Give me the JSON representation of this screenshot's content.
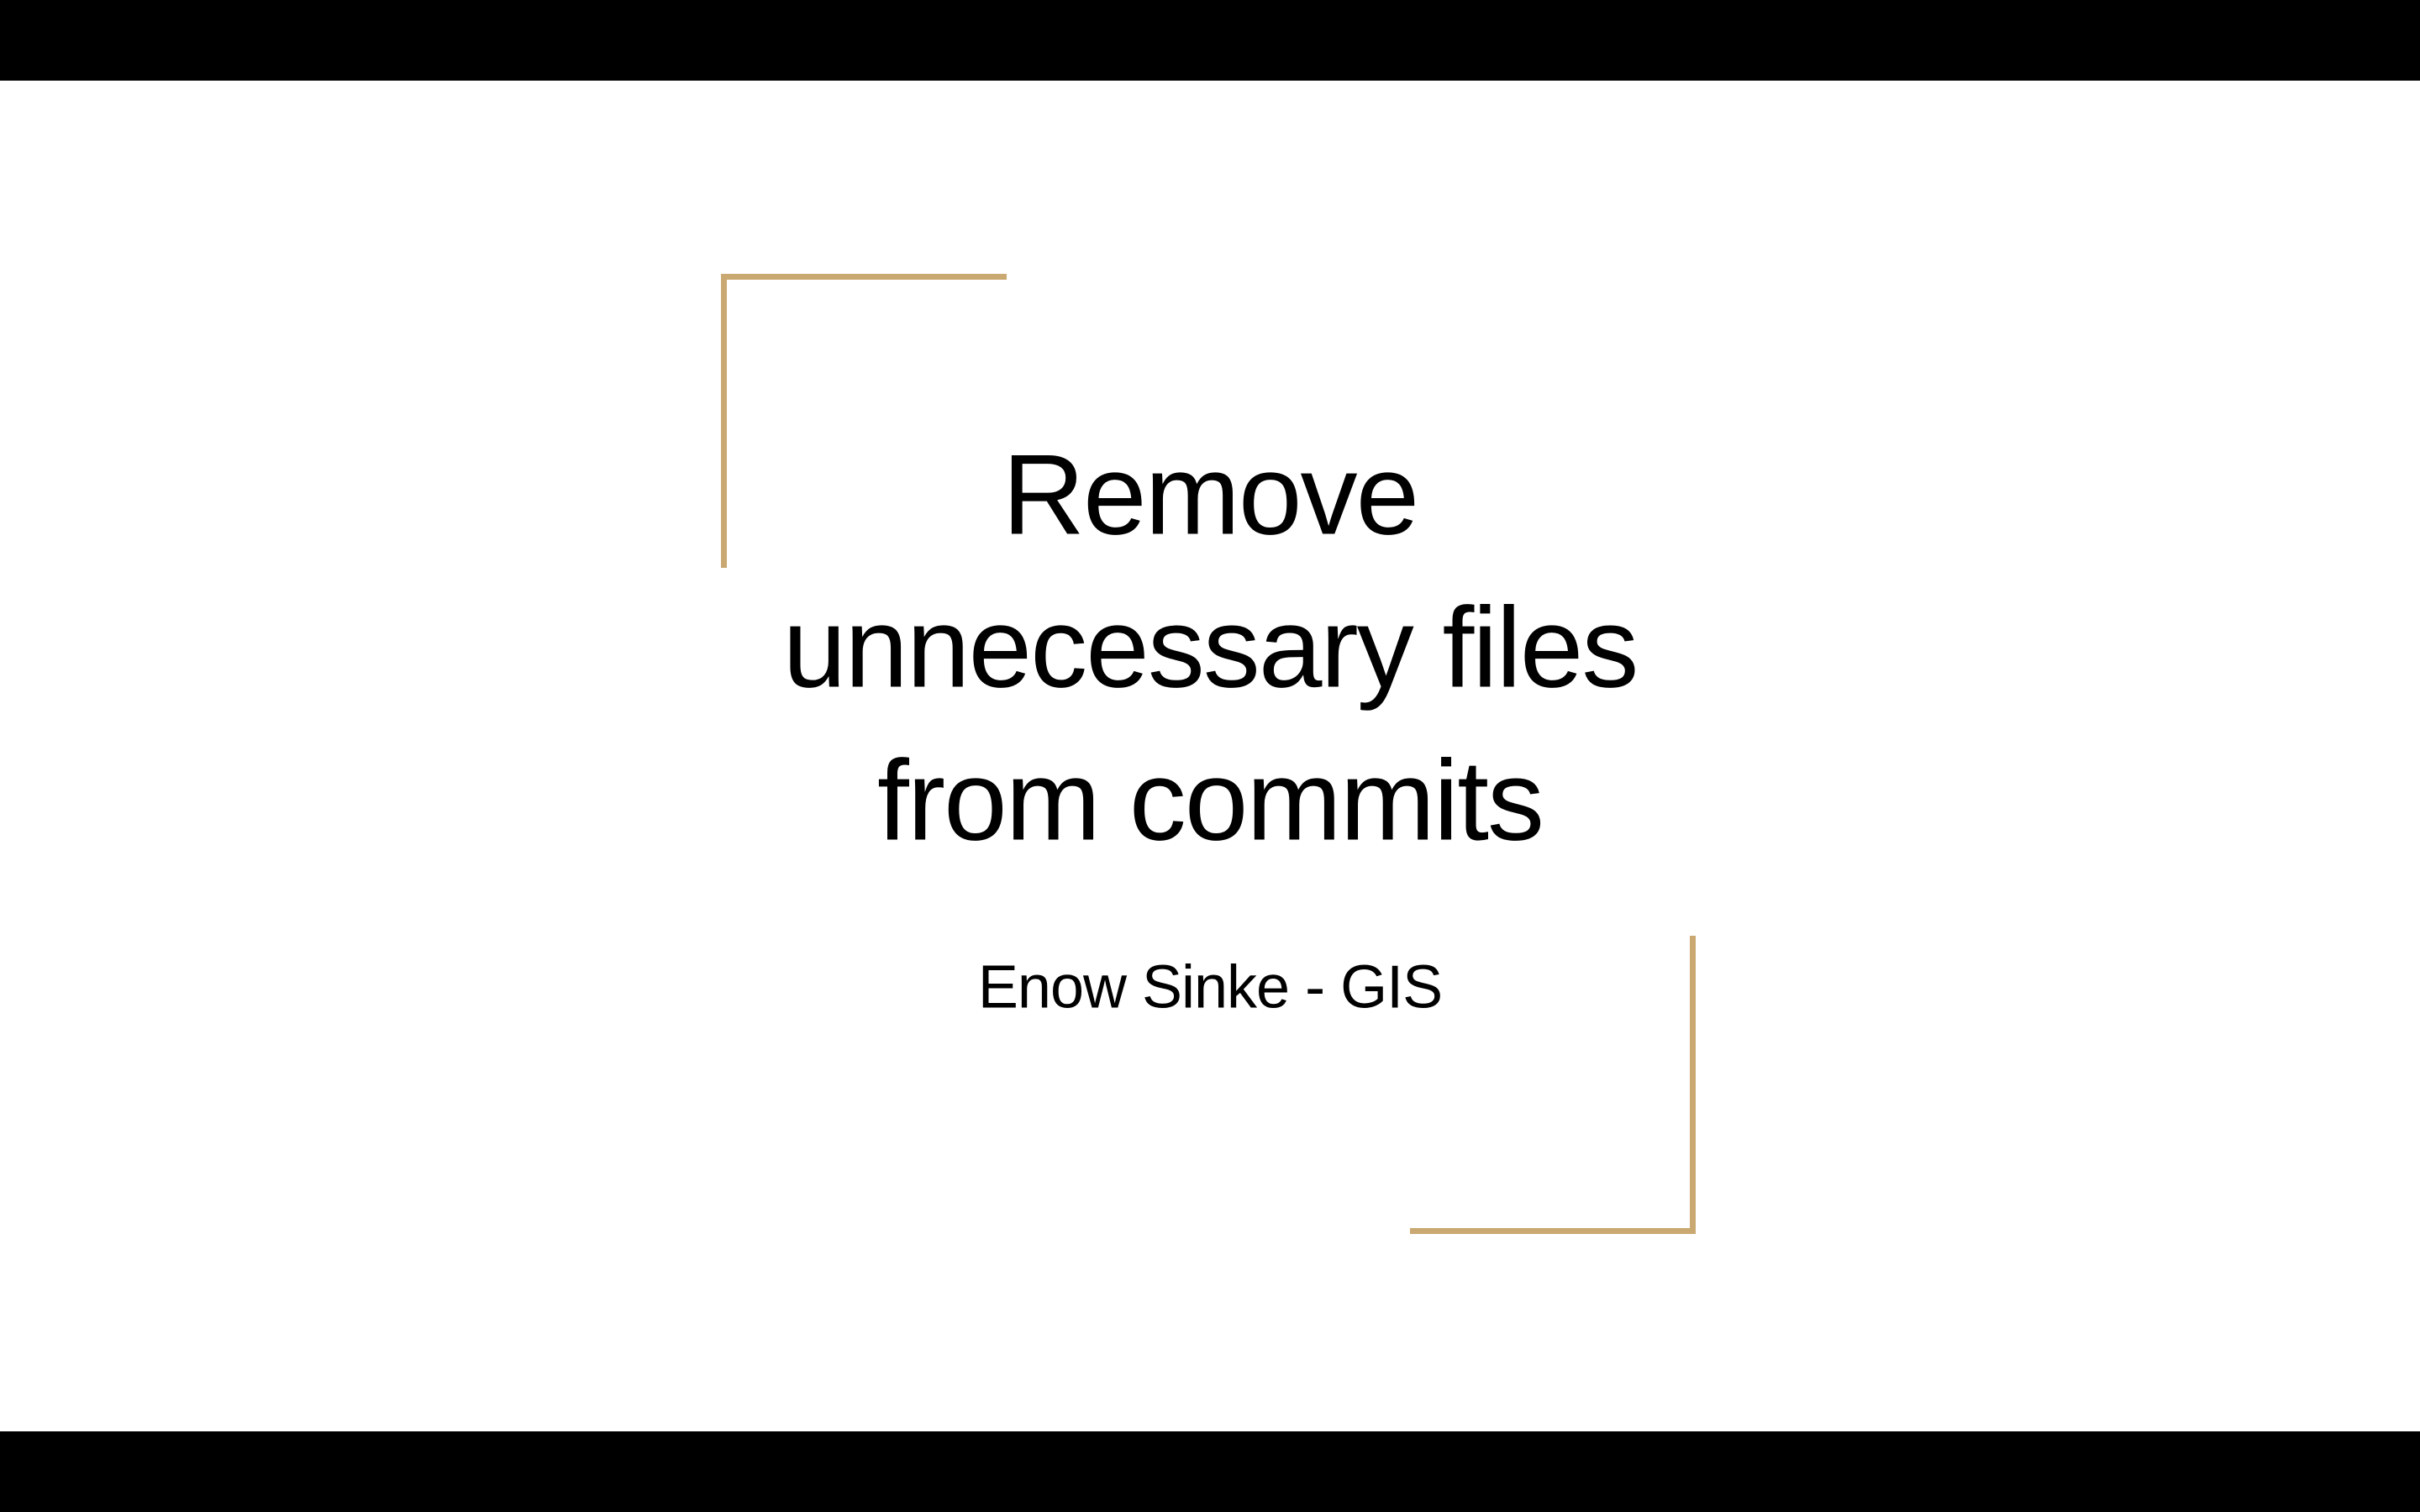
{
  "slide": {
    "title": {
      "line1": "Remove",
      "line2": "unnecessary files",
      "line3": "from commits"
    },
    "subtitle": "Enow Sinke - GIS"
  }
}
